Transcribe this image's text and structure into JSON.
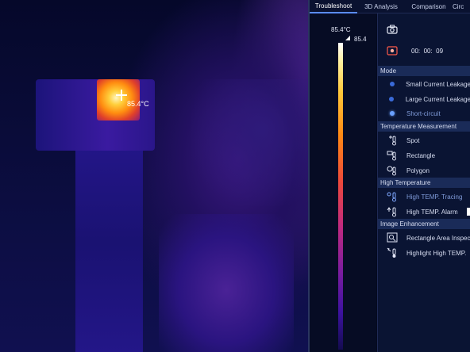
{
  "thermal": {
    "spot_temp": "85.4°C"
  },
  "tabs": [
    {
      "label": "Troubleshoot",
      "active": true
    },
    {
      "label": "3D Analysis",
      "active": false
    },
    {
      "label": "Comparison",
      "active": false
    },
    {
      "label": "Circ",
      "active": false
    }
  ],
  "scale": {
    "max_label": "85.4°C",
    "current_label": "85.4"
  },
  "panel": {
    "timer": "00:  00:  09",
    "mode": {
      "header": "Mode",
      "items": [
        {
          "label": "Small Current Leakage",
          "selected": false
        },
        {
          "label": "Large Current Leakage",
          "selected": false
        },
        {
          "label": "Short-circuit",
          "selected": true
        }
      ]
    },
    "measurement": {
      "header": "Temperature Measurement",
      "items": [
        {
          "label": "Spot",
          "icon": "spot-thermometer-icon"
        },
        {
          "label": "Rectangle",
          "icon": "rectangle-thermometer-icon"
        },
        {
          "label": "Polygon",
          "icon": "polygon-thermometer-icon"
        }
      ]
    },
    "high_temp": {
      "header": "High Temperature",
      "items": [
        {
          "label": "High TEMP. Tracing",
          "icon": "tracing-thermometer-icon",
          "active": true
        },
        {
          "label": "High TEMP.  Alarm",
          "icon": "alarm-thermometer-icon",
          "active": false
        }
      ]
    },
    "enhancement": {
      "header": "Image Enhancement",
      "items": [
        {
          "label": "Rectangle Area Inspec",
          "icon": "area-inspect-icon"
        },
        {
          "label": "Highlight High TEMP.",
          "icon": "highlight-icon"
        }
      ]
    }
  },
  "colors": {
    "accent": "#5a8cff",
    "panel_bg": "#0a1433",
    "section_bg": "#1a2b58"
  }
}
